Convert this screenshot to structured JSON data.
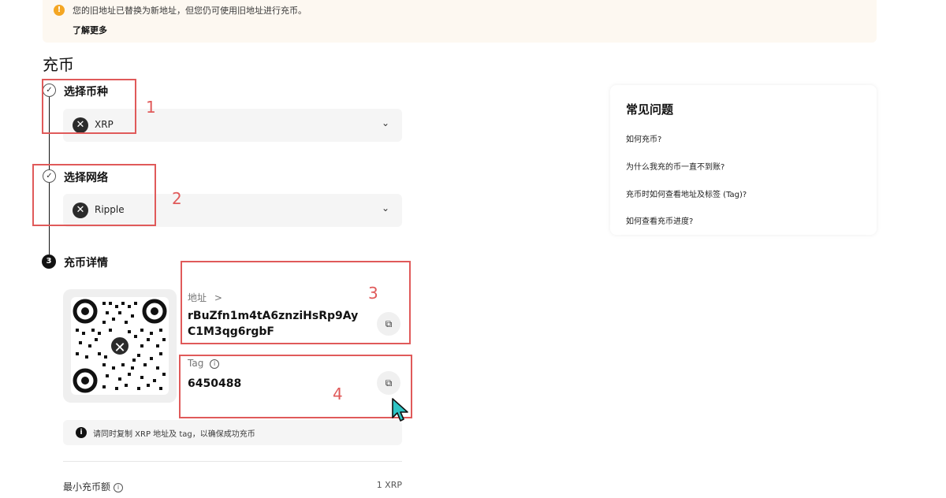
{
  "notice": {
    "message": "您的旧地址已替换为新地址，但您仍可使用旧地址进行充币。",
    "learn_more": "了解更多",
    "icon": "warning-icon"
  },
  "page_title": "充币",
  "steps": [
    {
      "index": "1",
      "title": "选择币种",
      "status": "done",
      "select_value": "XRP",
      "coin_icon": "xrp-icon"
    },
    {
      "index": "2",
      "title": "选择网络",
      "status": "done",
      "select_value": "Ripple",
      "coin_icon": "xrp-icon"
    },
    {
      "index": "3",
      "title": "充币详情",
      "status": "active"
    }
  ],
  "deposit": {
    "address_label": "地址",
    "address_value_line1": "rBuZfn1m4tA6znziHsRp9Ay",
    "address_value_line2": "C1M3qg6rgbF",
    "tag_label": "Tag",
    "tag_value": "6450488",
    "tip": "请同时复制 XRP 地址及 tag，以确保成功充币",
    "min_label": "最小充币额",
    "min_value": "1 XRP"
  },
  "annotations": [
    "1",
    "2",
    "3",
    "4"
  ],
  "faq": {
    "title": "常见问题",
    "items": [
      "如何充币?",
      "为什么我充的币一直不到账?",
      "充币时如何查看地址及标签 (Tag)?",
      "如何查看充币进度?"
    ]
  },
  "colors": {
    "annotation": "#e05a5a",
    "warning": "#f4a623",
    "banner_bg": "#fdf8f1",
    "cursor": "#2ec4c4"
  }
}
